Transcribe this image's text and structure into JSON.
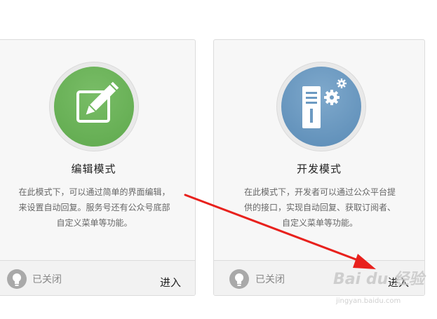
{
  "cards": [
    {
      "title": "编辑模式",
      "icon": "edit-pencil-icon",
      "desc": [
        "在此模式下，可以通过简单的界面编辑，",
        "来设置自动回复。服务号还有公众号底部",
        "自定义菜单等功能。"
      ],
      "status": "已关闭",
      "enter": "进入",
      "color": "#6ab457"
    },
    {
      "title": "开发模式",
      "icon": "server-gear-icon",
      "desc": [
        "在此模式下，开发者可以通过公众平台提",
        "供的接口，实现自动回复、获取订阅者、",
        "自定义菜单等功能。"
      ],
      "status": "已关闭",
      "enter": "进入",
      "color": "#6c9ac2"
    }
  ],
  "watermark": {
    "brand": "Bai du 经验",
    "url": "jingyan.baidu.com"
  },
  "colors": {
    "arrow": "#e8211d"
  }
}
